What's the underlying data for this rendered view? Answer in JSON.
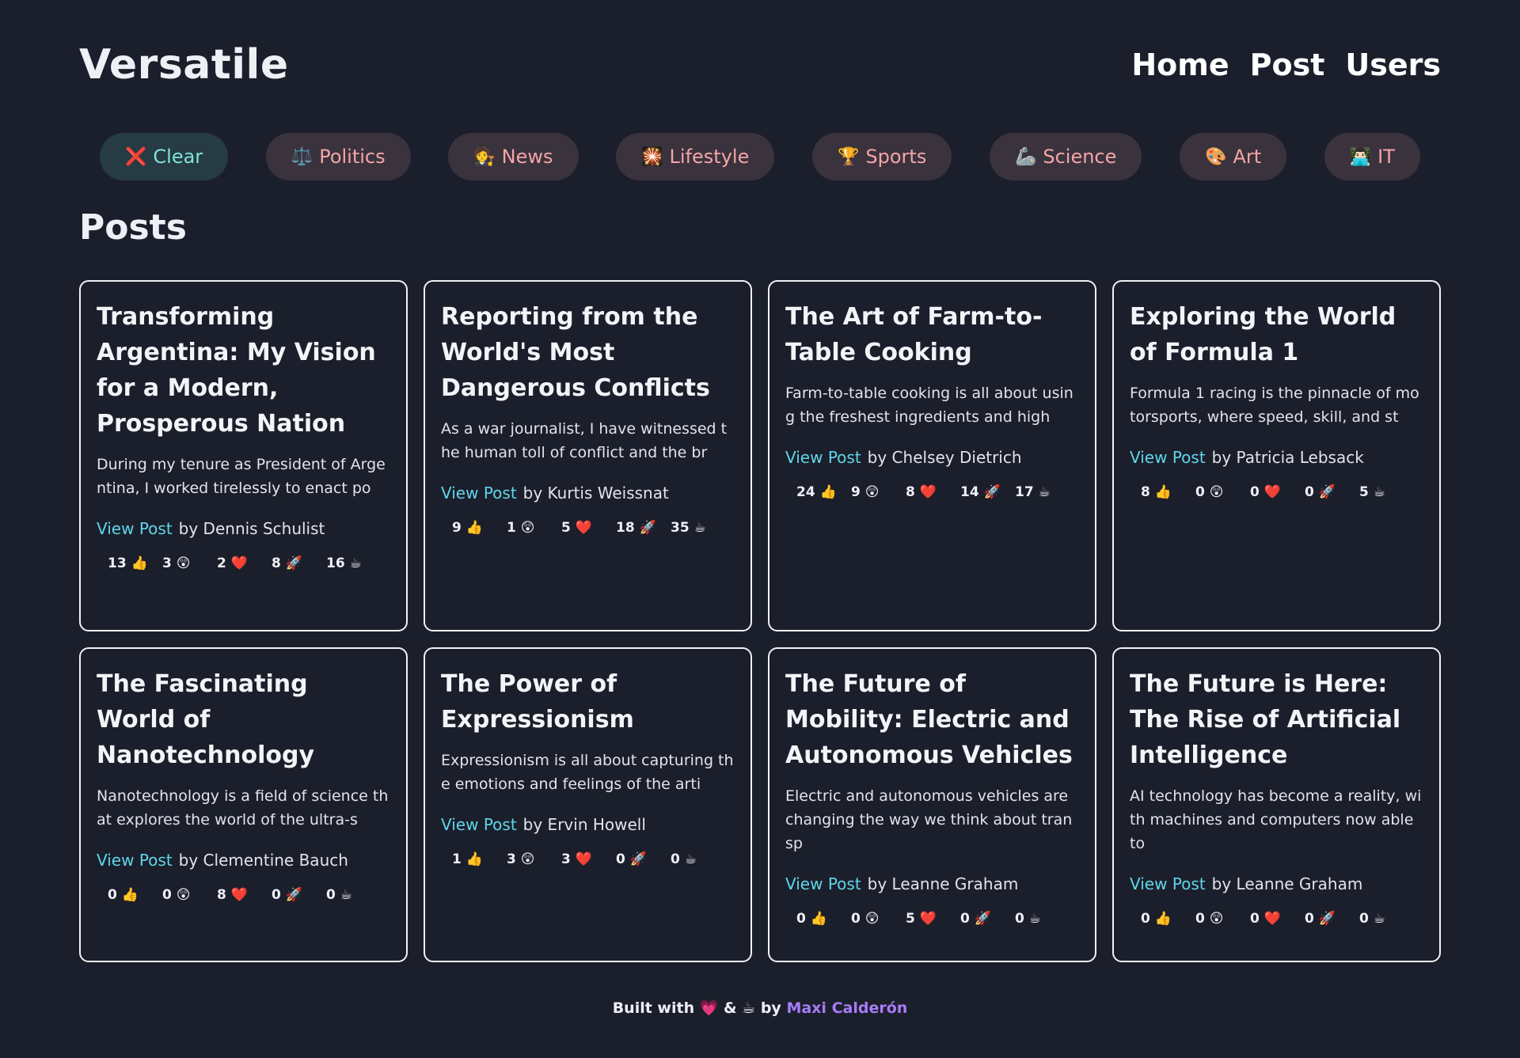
{
  "header": {
    "brand": "Versatile",
    "nav": [
      "Home",
      "Post",
      "Users"
    ]
  },
  "filters": [
    {
      "icon": "❌",
      "label": "Clear"
    },
    {
      "icon": "⚖️",
      "label": "Politics"
    },
    {
      "icon": "🧑‍⚖️",
      "label": "News"
    },
    {
      "icon": "🎇",
      "label": "Lifestyle"
    },
    {
      "icon": "🏆",
      "label": "Sports"
    },
    {
      "icon": "🦾",
      "label": "Science"
    },
    {
      "icon": "🎨",
      "label": "Art"
    },
    {
      "icon": "👨🏻‍💻",
      "label": "IT"
    }
  ],
  "section_title": "Posts",
  "view_label": "View Post",
  "posts": [
    {
      "title": "Transforming Argentina: My Vision for a Modern, Prosperous Nation",
      "excerpt": "During my tenure as President of Argentina, I worked tirelessly to enact po",
      "author": "by Dennis Schulist",
      "reactions": [
        "13 👍",
        "3 😲",
        "2 ❤️",
        "8 🚀",
        "16 ☕"
      ]
    },
    {
      "title": "Reporting from the World's Most Dangerous Conflicts",
      "excerpt": "As a war journalist, I have witnessed the human toll of conflict and the br",
      "author": "by Kurtis Weissnat",
      "reactions": [
        "9 👍",
        "1 😲",
        "5 ❤️",
        "18 🚀",
        "35 ☕"
      ]
    },
    {
      "title": "The Art of Farm-to-Table Cooking",
      "excerpt": "Farm-to-table cooking is all about using the freshest ingredients and high",
      "author": "by Chelsey Dietrich",
      "reactions": [
        "24 👍",
        "9 😲",
        "8 ❤️",
        "14 🚀",
        "17 ☕"
      ]
    },
    {
      "title": "Exploring the World of Formula 1",
      "excerpt": "Formula 1 racing is the pinnacle of motorsports, where speed, skill, and st",
      "author": "by Patricia Lebsack",
      "reactions": [
        "8 👍",
        "0 😲",
        "0 ❤️",
        "0 🚀",
        "5 ☕"
      ]
    },
    {
      "title": "The Fascinating World of Nanotechnology",
      "excerpt": "Nanotechnology is a field of science that explores the world of the ultra-s",
      "author": "by Clementine Bauch",
      "reactions": [
        "0 👍",
        "0 😲",
        "8 ❤️",
        "0 🚀",
        "0 ☕"
      ]
    },
    {
      "title": "The Power of Expressionism",
      "excerpt": "Expressionism is all about capturing the emotions and feelings of the arti",
      "author": "by Ervin Howell",
      "reactions": [
        "1 👍",
        "3 😲",
        "3 ❤️",
        "0 🚀",
        "0 ☕"
      ]
    },
    {
      "title": "The Future of Mobility: Electric and Autonomous Vehicles",
      "excerpt": "Electric and autonomous vehicles are changing the way we think about transp",
      "author": "by Leanne Graham",
      "reactions": [
        "0 👍",
        "0 😲",
        "5 ❤️",
        "0 🚀",
        "0 ☕"
      ]
    },
    {
      "title": "The Future is Here: The Rise of Artificial Intelligence",
      "excerpt": "AI technology has become a reality, with machines and computers now able to",
      "author": "by Leanne Graham",
      "reactions": [
        "0 👍",
        "0 😲",
        "0 ❤️",
        "0 🚀",
        "0 ☕"
      ]
    }
  ],
  "footer": {
    "text": "Built with 💗 & ☕ by",
    "author": "Maxi Calderón"
  }
}
